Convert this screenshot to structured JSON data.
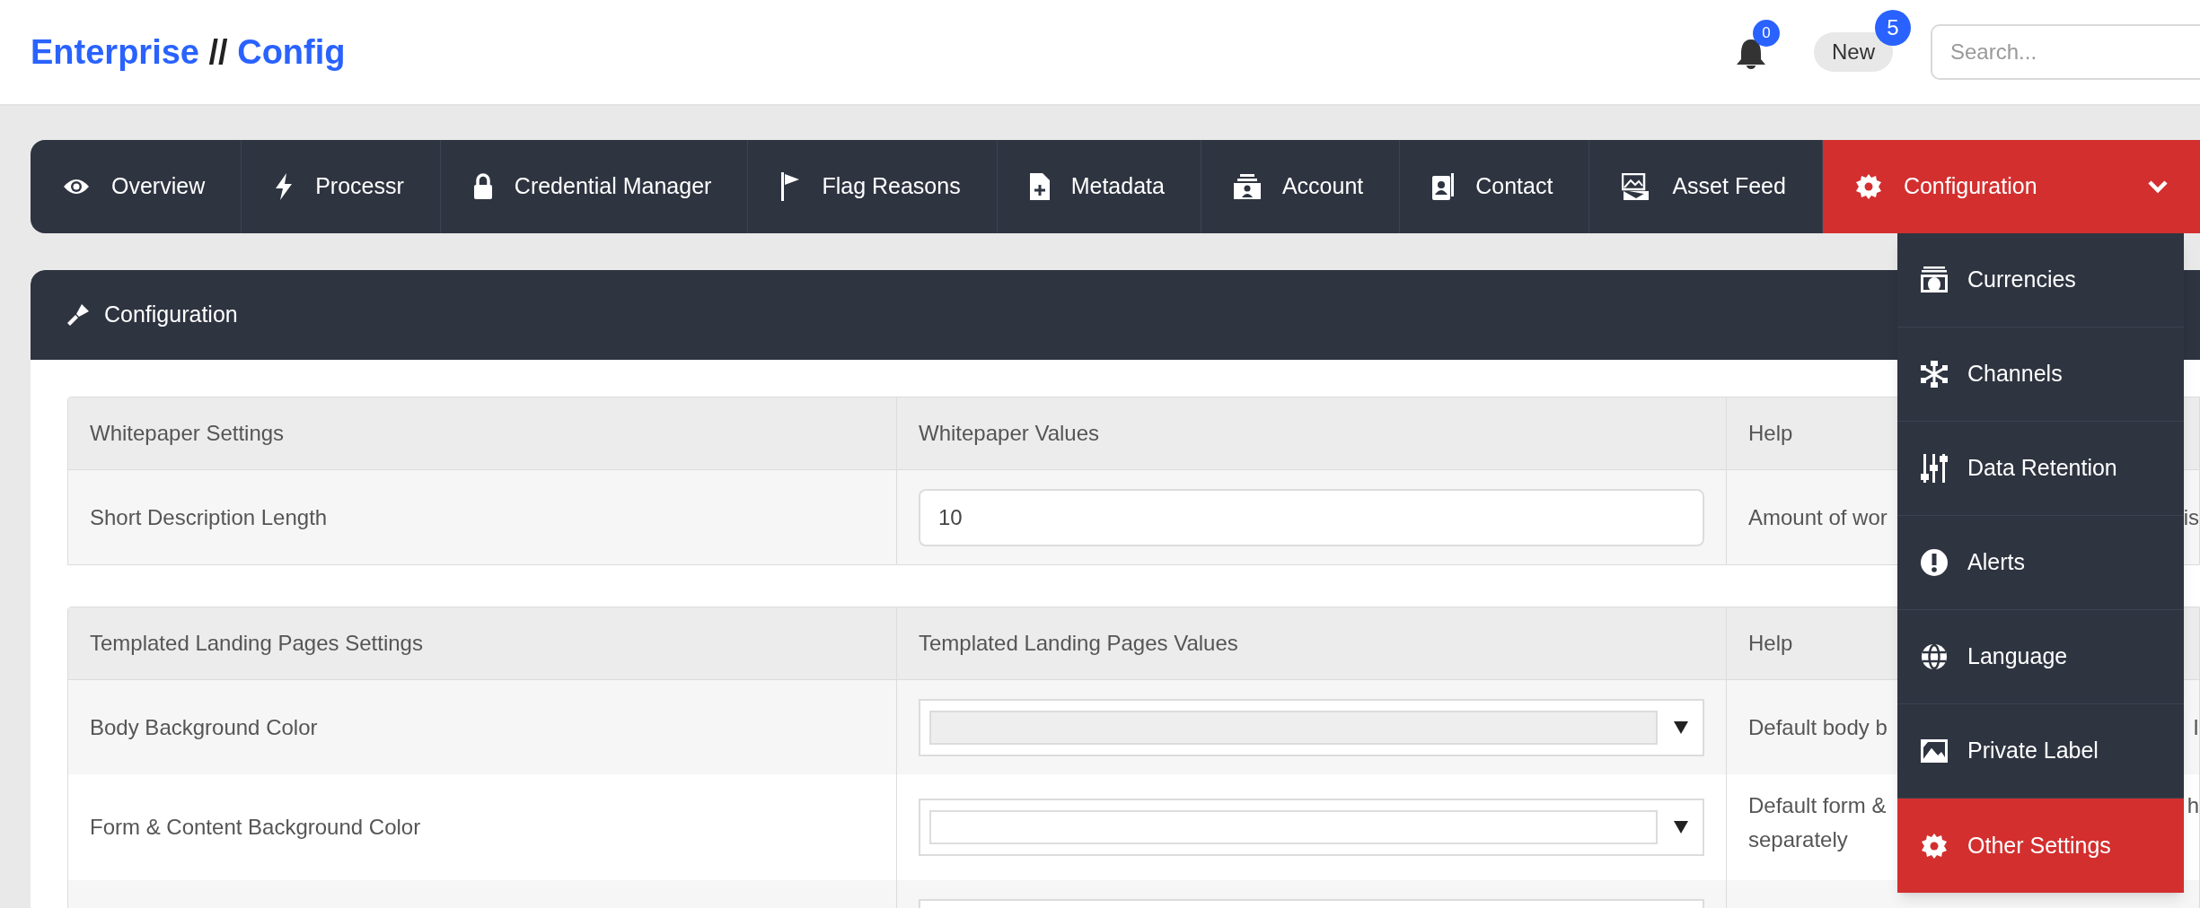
{
  "header": {
    "title": {
      "first": "Enterprise",
      "separator": "//",
      "second": "Config"
    },
    "notifications": {
      "count": "0"
    },
    "new_button": {
      "label": "New",
      "count": "5"
    },
    "search": {
      "placeholder": "Search..."
    }
  },
  "nav": {
    "items": [
      {
        "label": "Overview",
        "selected": false,
        "expanded": false
      },
      {
        "label": "Processr",
        "selected": false,
        "expanded": false
      },
      {
        "label": "Credential Manager",
        "selected": false,
        "expanded": false
      },
      {
        "label": "Flag Reasons",
        "selected": false,
        "expanded": false
      },
      {
        "label": "Metadata",
        "selected": false,
        "expanded": false
      },
      {
        "label": "Account",
        "selected": false,
        "expanded": false
      },
      {
        "label": "Contact",
        "selected": false,
        "expanded": false
      },
      {
        "label": "Asset Feed",
        "selected": false,
        "expanded": false
      },
      {
        "label": "Configuration",
        "selected": true,
        "expanded": true
      }
    ]
  },
  "dropdown": {
    "items": [
      {
        "label": "Currencies",
        "selected": false
      },
      {
        "label": "Channels",
        "selected": false
      },
      {
        "label": "Data Retention",
        "selected": false
      },
      {
        "label": "Alerts",
        "selected": false
      },
      {
        "label": "Language",
        "selected": false
      },
      {
        "label": "Private Label",
        "selected": false
      },
      {
        "label": "Other Settings",
        "selected": true
      }
    ]
  },
  "panel": {
    "title": "Configuration",
    "tables": [
      {
        "columns": [
          "Whitepaper Settings",
          "Whitepaper Values",
          "Help"
        ],
        "rows": [
          {
            "setting": "Short Description Length",
            "kind": "input",
            "value": "10",
            "help": [
              "Amount of wor"
            ],
            "help_tail": "is"
          }
        ]
      },
      {
        "columns": [
          "Templated Landing Pages Settings",
          "Templated Landing Pages Values",
          "Help"
        ],
        "rows": [
          {
            "setting": "Body Background Color",
            "kind": "select",
            "color": "#eeeeee",
            "help": [
              "Default body b"
            ],
            "help_tail": "I"
          },
          {
            "setting": "Form & Content Background Color",
            "kind": "select",
            "color": "#ffffff",
            "help": [
              "Default form &",
              "separately"
            ],
            "help_tail": "h"
          },
          {
            "kind": "select"
          }
        ]
      }
    ]
  }
}
